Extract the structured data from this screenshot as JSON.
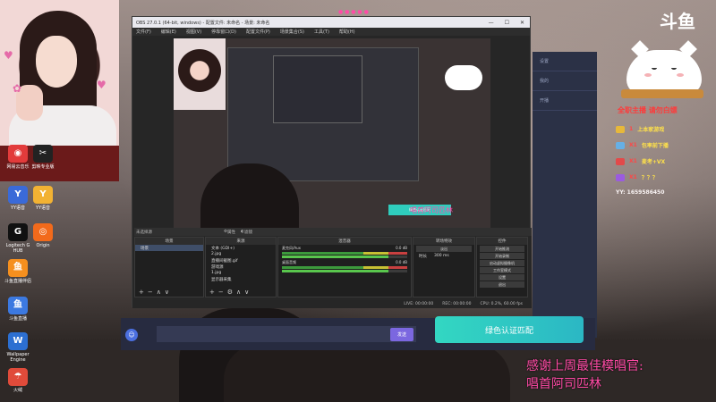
{
  "obs": {
    "title": "OBS 27.0.1 (64-bit, windows) - 配置文件: 未命名 - 场景: 未命名",
    "menu": [
      "文件(F)",
      "编辑(E)",
      "视图(V)",
      "停靠窗口(D)",
      "配置文件(P)",
      "场景集合(S)",
      "工具(T)",
      "帮助(H)"
    ],
    "scene_dock_label": "未选择源",
    "toolbar_props": "属性",
    "toolbar_filters": "滤镜",
    "scenes": {
      "header": "场景",
      "items": [
        "场景"
      ]
    },
    "sources": {
      "header": "来源",
      "items": [
        "文本 (GDI+)",
        "2.jpg",
        "直播间截图.gif",
        "游戏源",
        "1.jpg",
        "显示器采集"
      ]
    },
    "mixer": {
      "header": "混音器",
      "tracks": [
        {
          "name": "麦克风/Aux",
          "db": "0.0 dB"
        },
        {
          "name": "桌面音频",
          "db": "0.0 dB"
        }
      ]
    },
    "transitions": {
      "header": "转场特效",
      "type": "淡出",
      "duration_label": "时长",
      "duration": "300 ms"
    },
    "controls": {
      "header": "控件",
      "buttons": [
        "开始推流",
        "开始录制",
        "启动虚拟摄像机",
        "工作室模式",
        "设置",
        "退出"
      ]
    },
    "status": {
      "live": "LIVE: 00:00:00",
      "rec": "REC: 00:00:00",
      "cpu": "CPU: 0.2%, 60.00 fps"
    }
  },
  "right_overlay": {
    "title": "全职主播 请勿白嫖",
    "lines": [
      {
        "count": "1",
        "text": "上本家游戏"
      },
      {
        "count": "X1",
        "text": "包率前下播"
      },
      {
        "count": "X1",
        "text": "麦考+VX"
      },
      {
        "count": "X1",
        "text": "？？？"
      }
    ],
    "yy": "YY: 1659586450"
  },
  "brand": "斗鱼",
  "desktop_icons": [
    {
      "label": "网易云音乐",
      "glyph": "◉",
      "color": "#e23b3b"
    },
    {
      "label": "剪映专业版",
      "glyph": "✂",
      "color": "#222222"
    },
    {
      "label": "YY语音",
      "glyph": "Y",
      "color": "#3a6ad8"
    },
    {
      "label": "YY语音",
      "glyph": "Y",
      "color": "#f2b233"
    },
    {
      "label": "Logitech G HUB",
      "glyph": "G",
      "color": "#111111"
    },
    {
      "label": "Origin",
      "glyph": "◎",
      "color": "#f26a1b"
    },
    {
      "label": "斗鱼直播伴侣",
      "glyph": "鱼",
      "color": "#f58f1e"
    },
    {
      "label": "斗鱼直播",
      "glyph": "鱼",
      "color": "#3c79e0"
    },
    {
      "label": "Wallpaper Engine",
      "glyph": "W",
      "color": "#2c6fd1"
    },
    {
      "label": "火绒",
      "glyph": "☂",
      "color": "#e04b3a"
    }
  ],
  "bottom": {
    "send_label": "发送",
    "verify_label": "绿色认证匹配"
  },
  "thanks_text": [
    "感谢上周最佳模唱官:",
    "唱首阿司匹林"
  ],
  "song_overlay": "唱首阿司匹林",
  "right_panel_labels": [
    "设置",
    "我的",
    "开播"
  ]
}
